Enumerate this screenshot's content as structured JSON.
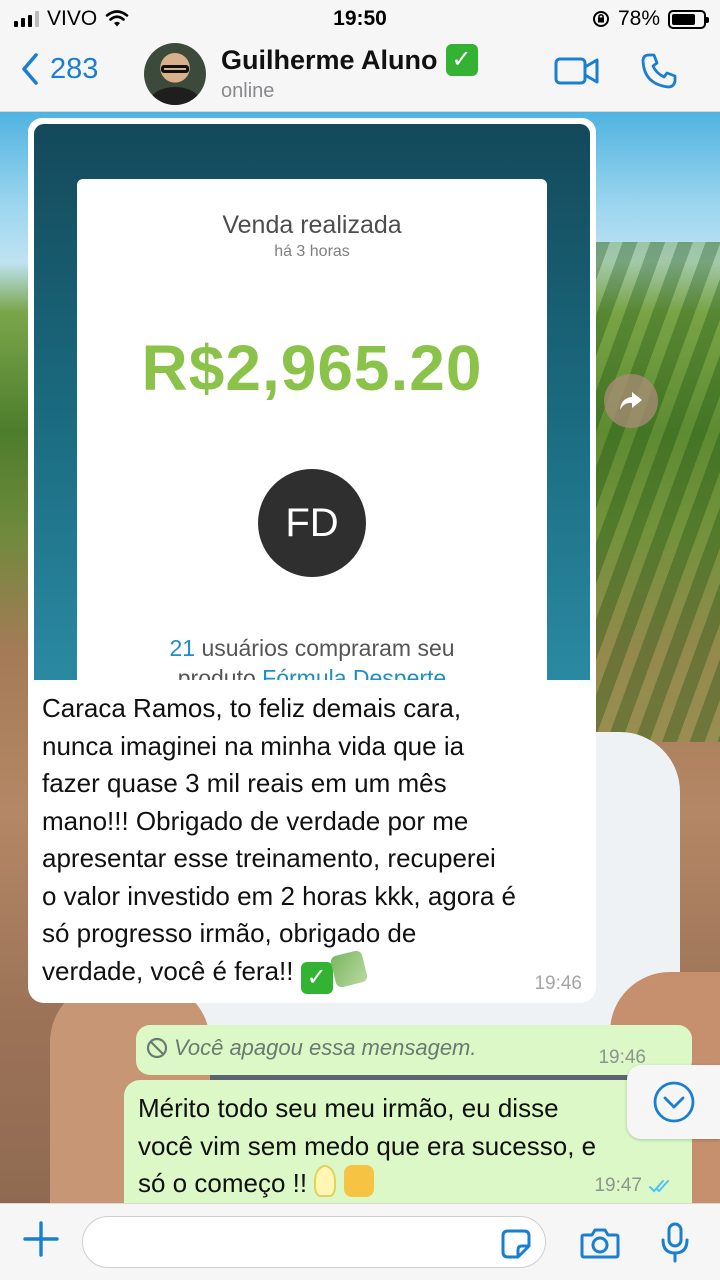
{
  "status_bar": {
    "carrier": "VIVO",
    "time": "19:50",
    "battery": "78%",
    "battery_level": 0.78
  },
  "header": {
    "back_count": "283",
    "contact_name": "Guilherme Aluno",
    "status": "online"
  },
  "image_card": {
    "title": "Venda realizada",
    "subtitle": "há 3 horas",
    "amount": "R$2,965.20",
    "initials": "FD",
    "buyers_count": "21",
    "description": "usuários compraram seu",
    "product_prefix": "produto",
    "product_name": "Fórmula Desperte"
  },
  "messages": {
    "incoming_text": "Caraca Ramos, to feliz demais cara,\nnunca imaginei na minha vida que ia\nfazer quase 3 mil reais em um mês\nmano!!! Obrigado de verdade por me\napresentar esse treinamento, recuperei\no valor investido em 2 horas kkk, agora é\nsó progresso irmão, obrigado de\nverdade, você é fera!!",
    "incoming_time": "19:46",
    "deleted_text": "Você apagou essa mensagem.",
    "deleted_time": "19:46",
    "reply_text": "Mérito todo seu meu irmão, eu disse\nvocê vim sem medo que era sucesso, e\nsó o começo !!",
    "reply_time": "19:47"
  },
  "input": {
    "placeholder": ""
  },
  "colors": {
    "accent": "#1a7fd1",
    "amount_green": "#8bc34a",
    "outgoing_bubble": "#dcf8c6",
    "incoming_bubble": "#ffffff",
    "read_ticks": "#4fc3f7"
  },
  "icons": {
    "back": "chevron-left-icon",
    "verified": "check-box-icon",
    "video": "video-camera-icon",
    "call": "phone-icon",
    "forward": "forward-arrow-icon",
    "deleted": "prohibited-icon",
    "scroll": "chevron-down-circle-icon",
    "plus": "plus-icon",
    "sticker": "sticker-icon",
    "camera": "camera-icon",
    "mic": "microphone-icon"
  }
}
